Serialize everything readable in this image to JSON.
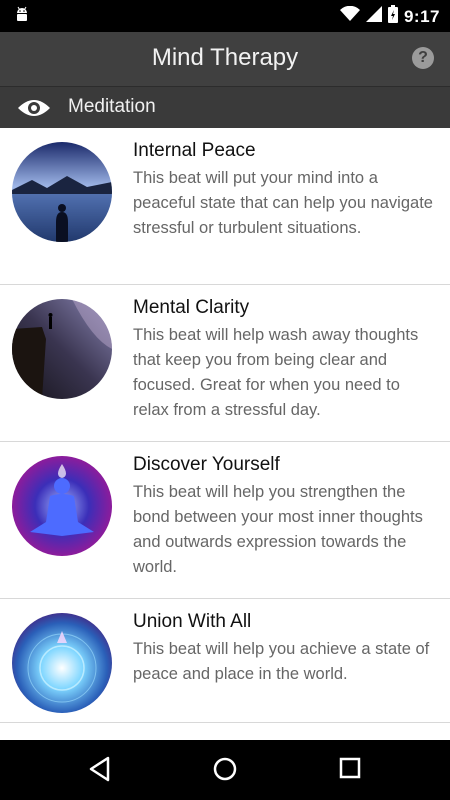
{
  "status_bar": {
    "time": "9:17",
    "icons": [
      "android-icon",
      "wifi-icon",
      "signal-icon",
      "battery-icon"
    ]
  },
  "app_bar": {
    "title": "Mind Therapy",
    "help_glyph": "?"
  },
  "section": {
    "icon": "eye-icon",
    "label": "Meditation"
  },
  "items": [
    {
      "title": "Internal Peace",
      "description": "This beat will put your mind into a peaceful state that can help you navigate stressful or turbulent situations."
    },
    {
      "title": "Mental Clarity",
      "description": "This beat will help wash away thoughts that keep you from being clear and focused. Great for when you need to relax from a stressful day."
    },
    {
      "title": "Discover Yourself",
      "description": "This beat will help you strengthen the bond between your most inner thoughts and outwards expression towards the world."
    },
    {
      "title": "Union With All",
      "description": "This beat will help you achieve a state of peace and place in the world."
    }
  ],
  "nav_bar": {
    "buttons": [
      "back-icon",
      "home-icon",
      "recents-icon"
    ]
  }
}
